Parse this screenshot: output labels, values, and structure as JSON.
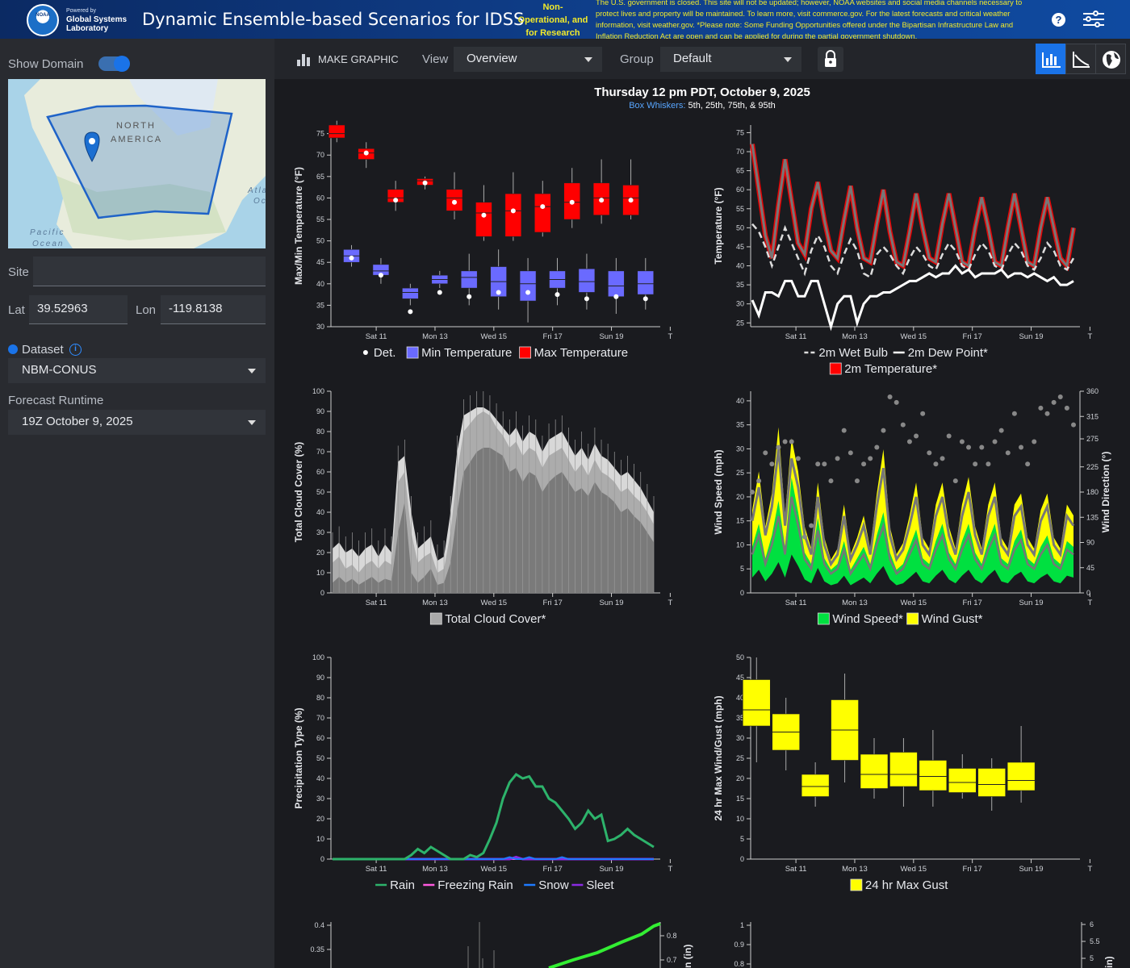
{
  "header": {
    "powered_by": "Powered by",
    "org_line1": "Global Systems",
    "org_line2": "Laboratory",
    "logo_text": "NOAA",
    "title": "Dynamic Ensemble-based Scenarios for IDSS",
    "nonop_line1": "Non-",
    "nonop_line2": "Operational, and",
    "nonop_line3": "for Research",
    "banner_lines": [
      "The U.S. government is closed. This site will not be updated; however, NOAA websites and social media channels necessary to",
      "protect lives and property will be maintained. To learn more, visit commerce.gov. For the latest forecasts and critical weather",
      "information, visit weather.gov. *Please note: Some Funding Opportunities offered under the Bipartisan Infrastructure Law and",
      "Inflation Reduction Act are open and can be applied for during the partial government shutdown."
    ],
    "help_icon": "?"
  },
  "sidebar": {
    "show_domain_label": "Show Domain",
    "map_labels": {
      "north": "NORTH",
      "america": "AMERICA",
      "pacific": "Pacific",
      "ocean": "Ocean",
      "atl": "Atla",
      "oc": "Oc"
    },
    "site_label": "Site",
    "site_value": "",
    "lat_label": "Lat",
    "lat_value": "39.52963",
    "lon_label": "Lon",
    "lon_value": "-119.8138",
    "dataset_label": "Dataset",
    "dataset_value": "NBM-CONUS",
    "runtime_label": "Forecast Runtime",
    "runtime_value": "19Z October 9, 2025"
  },
  "toolbar": {
    "make_graphic": "MAKE GRAPHIC",
    "view_label": "View",
    "view_value": "Overview",
    "group_label": "Group",
    "group_value": "Default"
  },
  "chart_header": {
    "title": "Thursday 12 pm PDT, October 9, 2025",
    "subtitle_link": "Box Whiskers:",
    "subtitle_rest": " 5th, 25th, 75th, & 95th"
  },
  "day_ticks": [
    "Sat 11",
    "Mon 13",
    "Wed 15",
    "Fri 17",
    "Sun 19",
    "T"
  ],
  "colors": {
    "max": "#ff0000",
    "min": "#6a6aff",
    "wind": "#00e040",
    "gust": "#ffff00",
    "rain": "#2db36b",
    "frz": "#ff5adf",
    "snow": "#1e7bff",
    "sleet": "#8a2be2"
  },
  "chart_data": [
    {
      "type": "box",
      "id": "maxmin",
      "ylabel": "Max/Min Temperature (°F)",
      "ylim": [
        30,
        77
      ],
      "yticks": [
        30,
        35,
        40,
        45,
        50,
        55,
        60,
        65,
        70,
        75
      ],
      "legend": [
        "Det.",
        "Min Temperature",
        "Max Temperature"
      ],
      "max_series": [
        {
          "x": 0.1,
          "p5": 73,
          "q1": 74,
          "q3": 77,
          "p95": 78,
          "med": 75,
          "det": null
        },
        {
          "x": 0.6,
          "p5": 67,
          "q1": 69,
          "q3": 71.5,
          "p95": 73,
          "med": 70.5,
          "det": 70.5
        },
        {
          "x": 1.1,
          "p5": 57,
          "q1": 59,
          "q3": 62,
          "p95": 64,
          "med": 60,
          "det": 59.5
        },
        {
          "x": 1.6,
          "p5": 62,
          "q1": 63,
          "q3": 64.5,
          "p95": 65,
          "med": 64,
          "det": 63.5
        },
        {
          "x": 2.1,
          "p5": 55,
          "q1": 57,
          "q3": 62,
          "p95": 66,
          "med": 60,
          "det": 59
        },
        {
          "x": 2.6,
          "p5": 50,
          "q1": 51,
          "q3": 59,
          "p95": 63,
          "med": 56.5,
          "det": 56
        },
        {
          "x": 3.1,
          "p5": 50,
          "q1": 51,
          "q3": 61,
          "p95": 66,
          "med": 57,
          "det": 57
        },
        {
          "x": 3.6,
          "p5": 51,
          "q1": 52,
          "q3": 61,
          "p95": 64,
          "med": 58,
          "det": 58
        },
        {
          "x": 4.1,
          "p5": 53,
          "q1": 55,
          "q3": 63.5,
          "p95": 67,
          "med": 59,
          "det": 59
        },
        {
          "x": 4.6,
          "p5": 54,
          "q1": 56,
          "q3": 63.5,
          "p95": 69,
          "med": 60,
          "det": 59.5
        },
        {
          "x": 5.1,
          "p5": 55,
          "q1": 56,
          "q3": 63,
          "p95": 69,
          "med": 60,
          "det": 59.5
        }
      ],
      "min_series": [
        {
          "x": 0.35,
          "p5": 44,
          "q1": 45,
          "q3": 48,
          "p95": 49,
          "med": 46.5,
          "det": 46
        },
        {
          "x": 0.85,
          "p5": 40,
          "q1": 42,
          "q3": 44.5,
          "p95": 46,
          "med": 43,
          "det": 42
        },
        {
          "x": 1.35,
          "p5": 35,
          "q1": 36.5,
          "q3": 39,
          "p95": 40,
          "med": 38,
          "det": 33.5
        },
        {
          "x": 1.85,
          "p5": 39,
          "q1": 40,
          "q3": 42,
          "p95": 43,
          "med": 41,
          "det": 38
        },
        {
          "x": 2.35,
          "p5": 35,
          "q1": 39,
          "q3": 43,
          "p95": 47,
          "med": 41.5,
          "det": 37
        },
        {
          "x": 2.85,
          "p5": 34,
          "q1": 37,
          "q3": 44,
          "p95": 48,
          "med": 40.5,
          "det": 38
        },
        {
          "x": 3.35,
          "p5": 31,
          "q1": 36,
          "q3": 43,
          "p95": 46,
          "med": 40,
          "det": 38
        },
        {
          "x": 3.85,
          "p5": 35,
          "q1": 39,
          "q3": 43,
          "p95": 46,
          "med": 41,
          "det": 37.5
        },
        {
          "x": 4.35,
          "p5": 34,
          "q1": 38,
          "q3": 43.5,
          "p95": 47,
          "med": 40.5,
          "det": 36.5
        },
        {
          "x": 4.85,
          "p5": 33,
          "q1": 37,
          "q3": 43,
          "p95": 46,
          "med": 39.5,
          "det": 37
        },
        {
          "x": 5.35,
          "p5": 34,
          "q1": 37.5,
          "q3": 43,
          "p95": 46,
          "med": 40,
          "det": 36.5
        }
      ]
    },
    {
      "type": "line",
      "id": "temps",
      "ylabel": "Temperature (°F)",
      "ylim": [
        24,
        77
      ],
      "yticks": [
        25,
        30,
        35,
        40,
        45,
        50,
        55,
        60,
        65,
        70,
        75
      ],
      "legend": [
        "2m Wet Bulb",
        "2m Dew Point*",
        "2m Temperature*"
      ],
      "temp": [
        72,
        60,
        48,
        42,
        56,
        68,
        57,
        46,
        43,
        55,
        62,
        52,
        44,
        42,
        52,
        61,
        50,
        42,
        41,
        51,
        60,
        49,
        41,
        40,
        49,
        59,
        50,
        42,
        41,
        51,
        59,
        50,
        41,
        40,
        50,
        58,
        50,
        41,
        40,
        50,
        59,
        50,
        41,
        40,
        50,
        58,
        50,
        42,
        40,
        50
      ],
      "wet": [
        51,
        49,
        45,
        40,
        45,
        50,
        46,
        42,
        38,
        44,
        48,
        45,
        40,
        38,
        43,
        47,
        44,
        38,
        37,
        43,
        45,
        43,
        40,
        38,
        42,
        45,
        43,
        40,
        39,
        43,
        46,
        44,
        40,
        39,
        43,
        46,
        44,
        40,
        39,
        43,
        46,
        44,
        40,
        39,
        42,
        46,
        44,
        40,
        39,
        42
      ],
      "dew": [
        31,
        27,
        33,
        33,
        32,
        36,
        36,
        32,
        32,
        36,
        36,
        30,
        24,
        30,
        32,
        32,
        25,
        30,
        32,
        32,
        33,
        33,
        34,
        35,
        36,
        36,
        37,
        38,
        37,
        38,
        38,
        40,
        38,
        39,
        37,
        38,
        38,
        38,
        39,
        37,
        38,
        38,
        37,
        38,
        37,
        36,
        37,
        35,
        35,
        36
      ]
    },
    {
      "type": "area",
      "id": "cloud",
      "ylabel": "Total Cloud Cover (%)",
      "ylim": [
        0,
        100
      ],
      "yticks": [
        0,
        10,
        20,
        30,
        40,
        50,
        60,
        70,
        80,
        90,
        100
      ],
      "legend": [
        "Total Cloud Cover*"
      ],
      "med": [
        5,
        8,
        5,
        7,
        4,
        6,
        8,
        5,
        7,
        6,
        30,
        45,
        10,
        5,
        8,
        12,
        4,
        5,
        15,
        40,
        60,
        65,
        70,
        72,
        72,
        70,
        68,
        60,
        62,
        55,
        60,
        58,
        50,
        55,
        58,
        60,
        55,
        50,
        52,
        48,
        55,
        50,
        48,
        45,
        40,
        42,
        38,
        35,
        30,
        25
      ],
      "p75": [
        15,
        18,
        12,
        14,
        10,
        14,
        16,
        12,
        16,
        14,
        55,
        60,
        30,
        15,
        18,
        20,
        10,
        12,
        30,
        60,
        80,
        84,
        88,
        90,
        88,
        82,
        78,
        72,
        75,
        68,
        72,
        70,
        62,
        68,
        70,
        72,
        66,
        60,
        64,
        58,
        66,
        60,
        58,
        55,
        50,
        52,
        48,
        45,
        40,
        34
      ],
      "p95": [
        22,
        25,
        20,
        22,
        18,
        22,
        24,
        18,
        24,
        20,
        65,
        68,
        40,
        22,
        25,
        28,
        16,
        18,
        40,
        70,
        88,
        90,
        92,
        92,
        90,
        86,
        82,
        78,
        82,
        75,
        80,
        78,
        70,
        76,
        78,
        80,
        74,
        68,
        72,
        66,
        74,
        68,
        66,
        62,
        58,
        60,
        56,
        52,
        46,
        40
      ]
    },
    {
      "type": "line",
      "id": "wind",
      "ylabel": "Wind Speed (mph)",
      "ylabel2": "Wind Direction (°)",
      "ylim": [
        0,
        42
      ],
      "y2lim": [
        0,
        360
      ],
      "yticks": [
        0,
        5,
        10,
        15,
        20,
        25,
        30,
        35,
        40
      ],
      "y2ticks": [
        0,
        45,
        90,
        135,
        180,
        225,
        275,
        315,
        360
      ],
      "legend": [
        "Wind Speed*",
        "Wind Gust*"
      ],
      "wind": [
        8,
        12,
        6,
        10,
        16,
        8,
        20,
        14,
        7,
        5,
        13,
        6,
        4,
        5,
        9,
        4,
        6,
        8,
        5,
        10,
        14,
        7,
        4,
        5,
        8,
        11,
        6,
        5,
        9,
        12,
        7,
        5,
        9,
        12,
        7,
        5,
        9,
        12,
        6,
        5,
        9,
        11,
        6,
        5,
        8,
        10,
        6,
        5,
        9,
        8
      ],
      "gust": [
        15,
        22,
        12,
        18,
        30,
        14,
        28,
        22,
        12,
        8,
        20,
        10,
        6,
        8,
        16,
        7,
        10,
        14,
        8,
        18,
        26,
        12,
        7,
        9,
        14,
        20,
        10,
        8,
        16,
        20,
        12,
        8,
        16,
        21,
        12,
        8,
        16,
        20,
        10,
        8,
        16,
        18,
        10,
        8,
        15,
        18,
        10,
        8,
        16,
        14
      ],
      "dir": [
        180,
        200,
        250,
        230,
        260,
        270,
        270,
        240,
        100,
        120,
        230,
        230,
        200,
        240,
        290,
        250,
        200,
        230,
        240,
        260,
        290,
        350,
        340,
        300,
        270,
        280,
        320,
        250,
        230,
        240,
        280,
        200,
        270,
        260,
        230,
        260,
        230,
        270,
        290,
        250,
        320,
        260,
        230,
        270,
        330,
        320,
        340,
        350,
        330,
        300
      ]
    },
    {
      "type": "line",
      "id": "ptype",
      "ylabel": "Precipitation Type (%)",
      "ylim": [
        0,
        100
      ],
      "yticks": [
        0,
        10,
        20,
        30,
        40,
        50,
        60,
        70,
        80,
        90,
        100
      ],
      "legend": [
        "Rain",
        "Freezing Rain",
        "Snow",
        "Sleet"
      ],
      "rain": [
        0,
        0,
        0,
        0,
        0,
        0,
        0,
        0,
        0,
        0,
        0,
        0,
        2,
        5,
        3,
        6,
        4,
        2,
        0,
        0,
        0,
        2,
        1,
        3,
        10,
        18,
        30,
        38,
        42,
        40,
        41,
        36,
        36,
        30,
        28,
        24,
        20,
        15,
        18,
        24,
        20,
        22,
        9,
        10,
        12,
        15,
        12,
        10,
        8,
        6
      ],
      "frz": [
        0,
        0,
        0,
        0,
        0,
        0,
        0,
        0,
        0,
        0,
        0,
        0,
        0,
        0,
        0,
        0,
        0,
        0,
        0,
        0,
        0,
        0,
        0,
        0,
        0,
        0,
        0,
        0,
        0,
        0,
        0,
        0,
        0,
        0,
        0,
        0,
        0,
        0,
        0,
        0,
        0,
        0,
        0,
        0,
        0,
        0,
        0,
        0,
        0,
        0
      ],
      "snow": [
        0,
        0,
        0,
        0,
        0,
        0,
        0,
        0,
        0,
        0,
        0,
        0,
        0,
        0,
        0,
        0,
        0,
        0,
        0,
        0,
        0,
        0,
        0,
        0,
        0,
        0,
        0,
        1,
        0,
        0,
        1,
        0,
        0,
        0,
        0,
        1,
        0,
        0,
        0,
        0,
        0,
        0,
        0,
        0,
        0,
        0,
        0,
        0,
        0,
        0
      ],
      "sleet": [
        0,
        0,
        0,
        0,
        0,
        0,
        0,
        0,
        0,
        0,
        0,
        0,
        0,
        0,
        0,
        0,
        0,
        0,
        0,
        0,
        0,
        0,
        0,
        0,
        0,
        0,
        0,
        0,
        1,
        0,
        0,
        0,
        0,
        0,
        0,
        0,
        0,
        0,
        0,
        0,
        0,
        0,
        0,
        0,
        0,
        0,
        0,
        0,
        0,
        0
      ]
    },
    {
      "type": "box",
      "id": "gust24",
      "ylabel": "24 hr Max Wind/Gust (mph)",
      "ylim": [
        0,
        50
      ],
      "yticks": [
        0,
        5,
        10,
        15,
        20,
        25,
        30,
        35,
        40,
        45,
        50
      ],
      "legend": [
        "24 hr Max Gust"
      ],
      "series": [
        {
          "x": 0.1,
          "p5": 24,
          "q1": 33,
          "q3": 44.5,
          "p95": 50,
          "med": 37
        },
        {
          "x": 0.6,
          "p5": 22,
          "q1": 27,
          "q3": 36,
          "p95": 40,
          "med": 31.5
        },
        {
          "x": 1.1,
          "p5": 13,
          "q1": 15.5,
          "q3": 21,
          "p95": 24,
          "med": 18
        },
        {
          "x": 1.6,
          "p5": 19,
          "q1": 24.5,
          "q3": 39.5,
          "p95": 46,
          "med": 32
        },
        {
          "x": 2.1,
          "p5": 15,
          "q1": 17.5,
          "q3": 26,
          "p95": 30,
          "med": 21
        },
        {
          "x": 2.6,
          "p5": 13,
          "q1": 18,
          "q3": 26.5,
          "p95": 30,
          "med": 21
        },
        {
          "x": 3.1,
          "p5": 13,
          "q1": 17,
          "q3": 24.5,
          "p95": 32,
          "med": 20.5
        },
        {
          "x": 3.6,
          "p5": 15,
          "q1": 16.5,
          "q3": 22.5,
          "p95": 26,
          "med": 19
        },
        {
          "x": 4.1,
          "p5": 12,
          "q1": 15.5,
          "q3": 22.5,
          "p95": 25,
          "med": 18.5
        },
        {
          "x": 4.6,
          "p5": 14,
          "q1": 17,
          "q3": 24,
          "p95": 33,
          "med": 19.5
        }
      ]
    },
    {
      "type": "line",
      "id": "precip-partial",
      "yticks": [
        "0.4",
        "0.35"
      ],
      "y2ticks": [
        "0.8",
        "0.7"
      ],
      "ylabel2_partial": "n (in)"
    },
    {
      "type": "line",
      "id": "snow-partial",
      "yticks": [
        "1",
        "0.9",
        "0.8"
      ],
      "y2ticks": [
        "6",
        "5.5",
        "5"
      ],
      "ylabel2_partial": "in)"
    }
  ]
}
